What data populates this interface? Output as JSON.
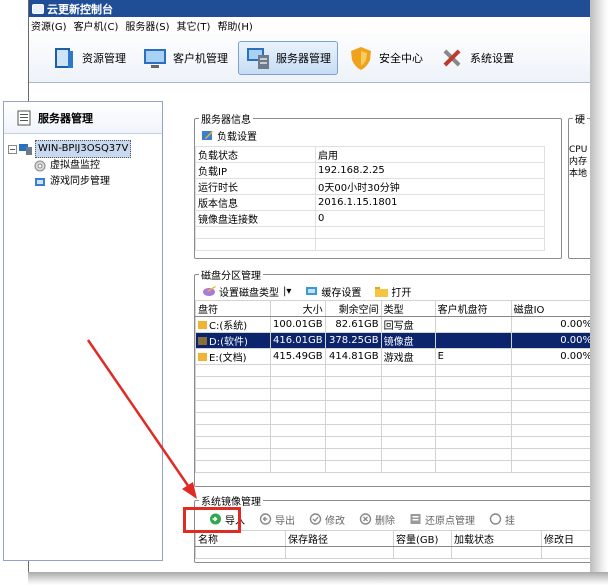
{
  "window": {
    "title": "云更新控制台"
  },
  "menu": [
    "资源(G)",
    "客户机(C)",
    "服务器(S)",
    "其它(T)",
    "帮助(H)"
  ],
  "toolbar": [
    {
      "label": "资源管理",
      "icon": "resource-icon",
      "active": false
    },
    {
      "label": "客户机管理",
      "icon": "client-monitor-icon",
      "active": false
    },
    {
      "label": "服务器管理",
      "icon": "server-icon",
      "active": true
    },
    {
      "label": "安全中心",
      "icon": "shield-icon",
      "active": false
    },
    {
      "label": "系统设置",
      "icon": "tools-icon",
      "active": false
    }
  ],
  "left": {
    "title": "服务器管理",
    "server": "WIN-BPIJ3OSQ37V",
    "children": [
      "虚拟盘监控",
      "游戏同步管理"
    ]
  },
  "server_info": {
    "legend": "服务器信息",
    "load_button": "负载设置",
    "rows": [
      [
        "负载状态",
        "启用"
      ],
      [
        "负载IP",
        "192.168.2.25"
      ],
      [
        "运行时长",
        "0天00小时30分钟"
      ],
      [
        "版本信息",
        "2016.1.15.1801"
      ],
      [
        "镜像盘连接数",
        "0"
      ]
    ]
  },
  "hw": {
    "legend": "硬",
    "lines": [
      "CPU",
      "内存",
      "本地"
    ]
  },
  "disk": {
    "legend": "磁盘分区管理",
    "set_type": "设置磁盘类型",
    "cache": "缓存设置",
    "open": "打开",
    "columns": [
      "盘符",
      "大小",
      "剩余空间",
      "类型",
      "客户机盘符",
      "磁盘IO"
    ],
    "rows": [
      [
        "C:(系统)",
        "100.01GB",
        "82.61GB",
        "回写盘",
        "",
        "0.00%"
      ],
      [
        "D:(软件)",
        "416.01GB",
        "378.25GB",
        "镜像盘",
        "",
        "0.00%"
      ],
      [
        "E:(文档)",
        "415.49GB",
        "414.81GB",
        "游戏盘",
        "E",
        "0.00%"
      ]
    ],
    "selected_row": 1
  },
  "image": {
    "legend": "系统镜像管理",
    "buttons": {
      "import": "导入",
      "export": "导出",
      "edit": "修改",
      "delete": "删除",
      "restore": "还原点管理",
      "mount": "挂"
    },
    "columns": [
      "名称",
      "保存路径",
      "容量(GB)",
      "加载状态",
      "修改日"
    ]
  },
  "annotation_color": "#e02a24"
}
